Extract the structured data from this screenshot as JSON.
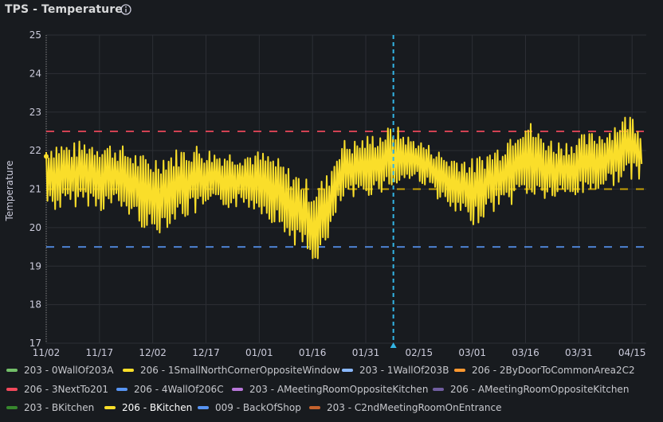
{
  "panel": {
    "title": "TPS - Temperature",
    "info_icon": "info-circle-icon"
  },
  "chart_data": {
    "type": "line",
    "title": "TPS - Temperature",
    "ylabel": "Temperature",
    "xlabel": "",
    "ylim": [
      17,
      25
    ],
    "yticks": [
      17,
      18,
      19,
      20,
      21,
      22,
      23,
      24,
      25
    ],
    "xlim": [
      "11/02",
      "04/19"
    ],
    "xticks": [
      "11/02",
      "11/17",
      "12/02",
      "12/17",
      "01/01",
      "01/16",
      "01/31",
      "02/15",
      "03/01",
      "03/16",
      "03/31",
      "04/15"
    ],
    "grid": true,
    "legend_position": "bottom",
    "thresholds": [
      {
        "value": 22.5,
        "color": "#f2495c",
        "style": "dashed"
      },
      {
        "value": 21,
        "color": "#e0b400",
        "style": "dashed"
      },
      {
        "value": 19.5,
        "color": "#5794f2",
        "style": "dashed"
      }
    ],
    "cursor_x": "02/08",
    "series": [
      {
        "name": "206 - BKitchen",
        "color": "#fade2a",
        "x": [
          "11/02",
          "11/05",
          "11/09",
          "11/13",
          "11/17",
          "11/21",
          "11/25",
          "11/29",
          "12/02",
          "12/06",
          "12/10",
          "12/14",
          "12/17",
          "12/21",
          "12/25",
          "12/29",
          "01/01",
          "01/05",
          "01/09",
          "01/13",
          "01/16",
          "01/20",
          "01/24",
          "01/28",
          "01/31",
          "02/04",
          "02/08",
          "02/12",
          "02/15",
          "02/19",
          "02/23",
          "02/27",
          "03/01",
          "03/05",
          "03/09",
          "03/13",
          "03/16",
          "03/20",
          "03/24",
          "03/28",
          "03/31",
          "04/04",
          "04/08",
          "04/12",
          "04/15",
          "04/18"
        ],
        "min": [
          20.5,
          20.4,
          20.5,
          20.6,
          20.4,
          20.5,
          20.3,
          20.0,
          19.7,
          20.0,
          20.2,
          20.3,
          20.4,
          20.5,
          20.5,
          20.5,
          20.4,
          20.1,
          19.7,
          19.4,
          19.0,
          19.4,
          20.6,
          20.7,
          20.8,
          20.9,
          21.0,
          21.2,
          21.2,
          20.9,
          20.4,
          20.2,
          20.0,
          20.3,
          20.5,
          20.6,
          20.8,
          20.7,
          20.7,
          20.7,
          20.8,
          20.9,
          21.0,
          21.2,
          21.2,
          21.3
        ],
        "max": [
          22.2,
          22.3,
          22.2,
          22.3,
          22.3,
          22.2,
          22.1,
          21.9,
          21.9,
          22.0,
          22.1,
          22.2,
          22.1,
          22.0,
          22.0,
          22.0,
          22.0,
          21.9,
          21.6,
          21.4,
          21.1,
          21.4,
          22.3,
          22.3,
          22.4,
          22.5,
          22.7,
          22.4,
          22.3,
          22.1,
          21.9,
          21.9,
          21.8,
          22.0,
          22.2,
          22.7,
          22.9,
          22.5,
          22.3,
          22.3,
          22.4,
          22.5,
          22.6,
          22.9,
          23.0,
          22.6
        ]
      }
    ]
  },
  "legend": {
    "items": [
      {
        "label": "203 - 0WallOf203A",
        "color": "#73bf69"
      },
      {
        "label": "206 - 1SmallNorthCornerOppositeWindow",
        "color": "#fade2a"
      },
      {
        "label": "203 - 1WallOf203B",
        "color": "#8ab8ff"
      },
      {
        "label": "206 - 2ByDoorToCommonArea2C2",
        "color": "#ff9830"
      },
      {
        "label": "206 - 3NextTo201",
        "color": "#f2495c"
      },
      {
        "label": "206 - 4WallOf206C",
        "color": "#5794f2"
      },
      {
        "label": "203 - AMeetingRoomOppositeKitchen",
        "color": "#b877d9"
      },
      {
        "label": "206 - AMeetingRoomOppositeKitchen",
        "color": "#705da0"
      },
      {
        "label": "203 - BKitchen",
        "color": "#37872d"
      },
      {
        "label": "206 - BKitchen",
        "color": "#fade2a"
      },
      {
        "label": "009 - BackOfShop",
        "color": "#5794f2"
      },
      {
        "label": "203 - C2ndMeetingRoomOnEntrance",
        "color": "#c4622d"
      }
    ]
  }
}
